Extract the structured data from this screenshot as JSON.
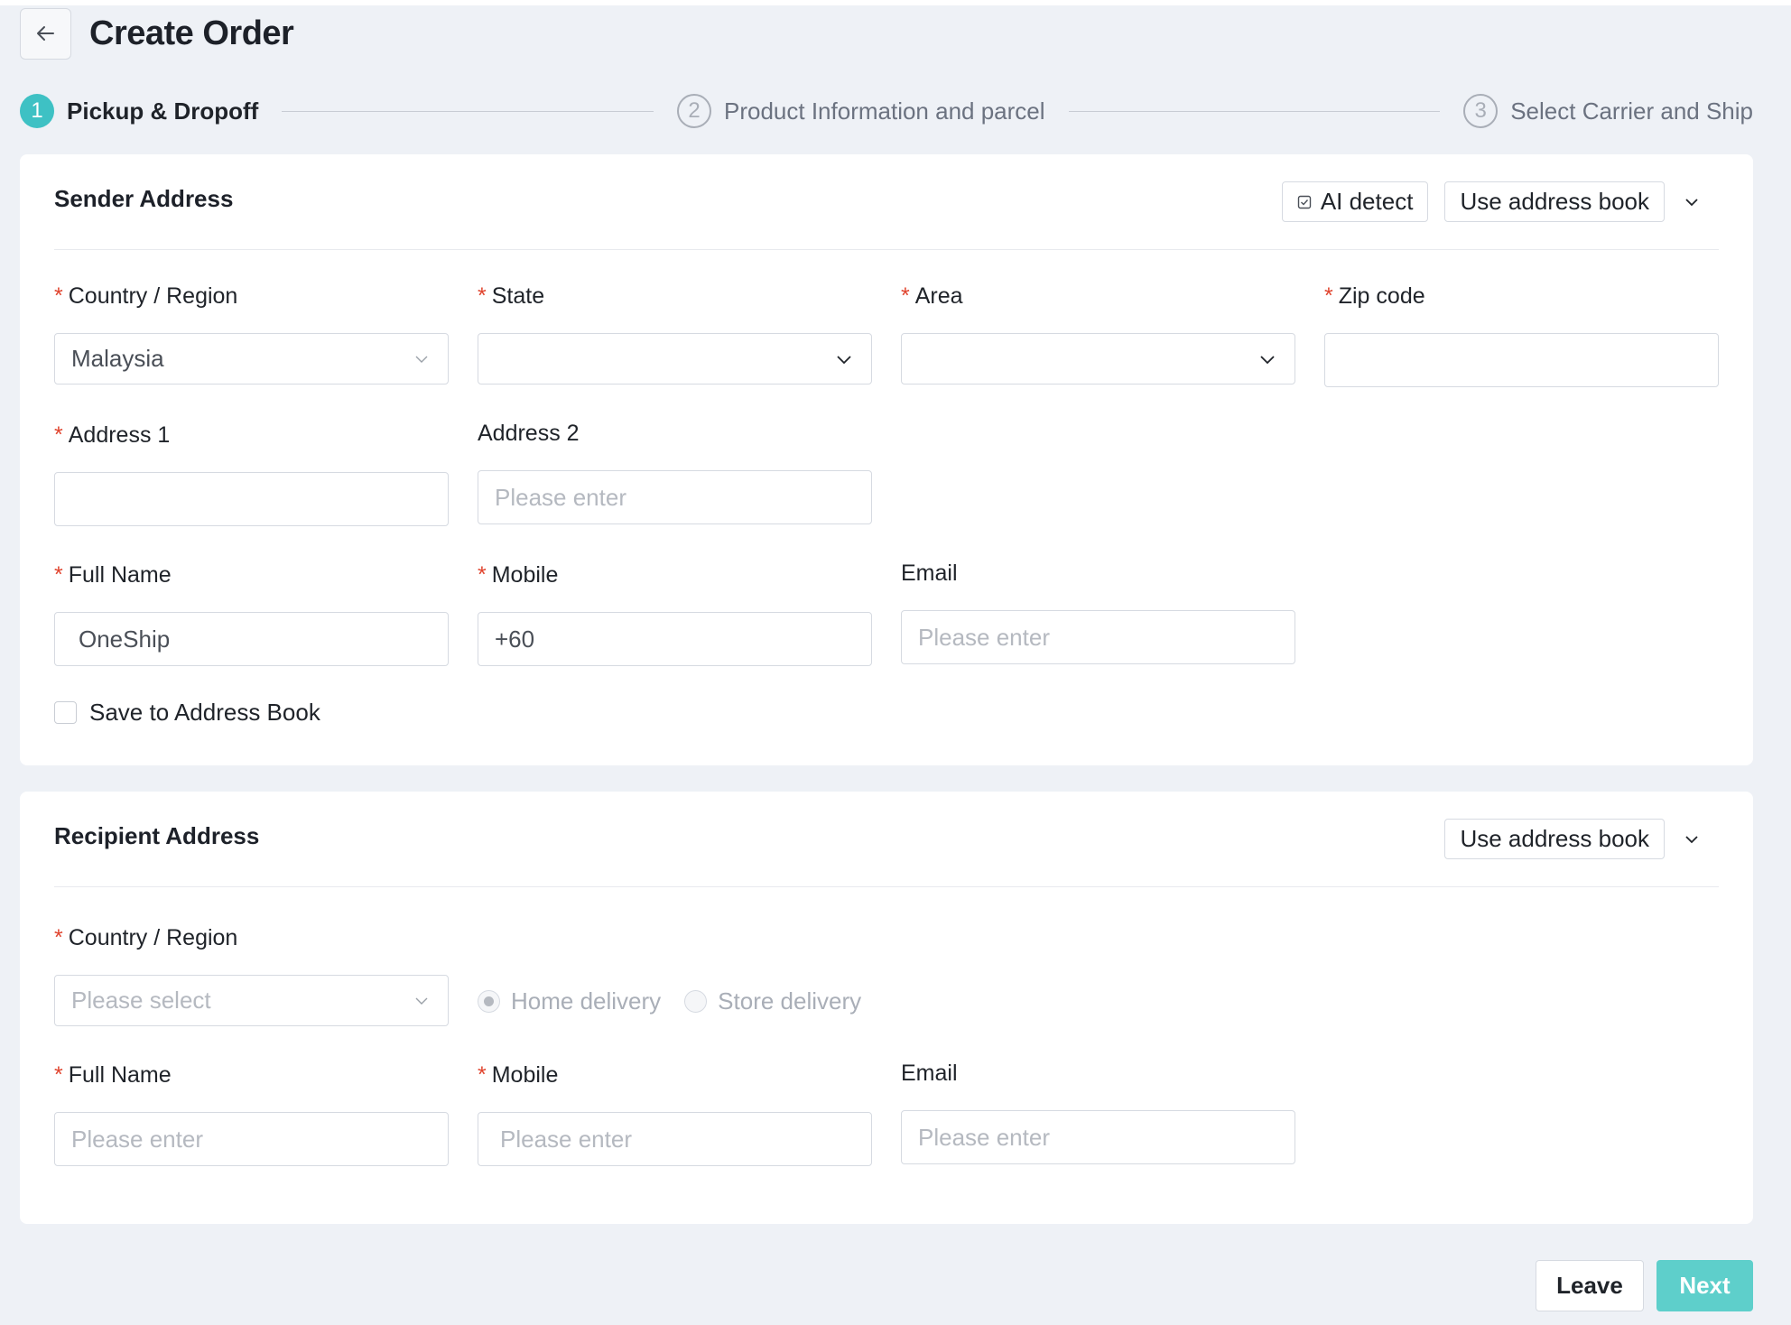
{
  "page": {
    "title": "Create Order"
  },
  "steps": [
    {
      "number": "1",
      "label": "Pickup & Dropoff",
      "state": "active"
    },
    {
      "number": "2",
      "label": "Product Information and parcel",
      "state": "inactive"
    },
    {
      "number": "3",
      "label": "Select Carrier and Ship",
      "state": "inactive"
    }
  ],
  "sender": {
    "title": "Sender Address",
    "ai_detect_label": "AI detect",
    "address_book_label": "Use address book",
    "country": {
      "label": "Country / Region",
      "value": "Malaysia"
    },
    "state": {
      "label": "State",
      "value": ""
    },
    "area": {
      "label": "Area",
      "value": ""
    },
    "zip": {
      "label": "Zip code",
      "value": ""
    },
    "address1": {
      "label": "Address 1",
      "value": ""
    },
    "address2": {
      "label": "Address 2",
      "placeholder": "Please enter"
    },
    "full_name": {
      "label": "Full Name",
      "value": "OneShip"
    },
    "mobile": {
      "label": "Mobile",
      "value": "+60"
    },
    "email": {
      "label": "Email",
      "placeholder": "Please enter"
    },
    "save_label": "Save to Address Book"
  },
  "recipient": {
    "title": "Recipient Address",
    "address_book_label": "Use address book",
    "country": {
      "label": "Country / Region",
      "placeholder": "Please select"
    },
    "delivery_options": [
      {
        "label": "Home delivery",
        "selected": true
      },
      {
        "label": "Store delivery",
        "selected": false
      }
    ],
    "full_name": {
      "label": "Full Name",
      "placeholder": "Please enter"
    },
    "mobile": {
      "label": "Mobile",
      "placeholder": "Please enter"
    },
    "email": {
      "label": "Email",
      "placeholder": "Please enter"
    }
  },
  "footer": {
    "leave_label": "Leave",
    "next_label": "Next"
  },
  "colors": {
    "accent": "#3ec1c4",
    "next_button": "#5ecfcb",
    "required": "#e0442e",
    "background": "#eef1f6"
  },
  "icons": {
    "back": "arrow-left-icon",
    "collapse": "chevron-down-icon",
    "ai_detect": "checkbox-icon",
    "select": "chevron-down-icon"
  }
}
